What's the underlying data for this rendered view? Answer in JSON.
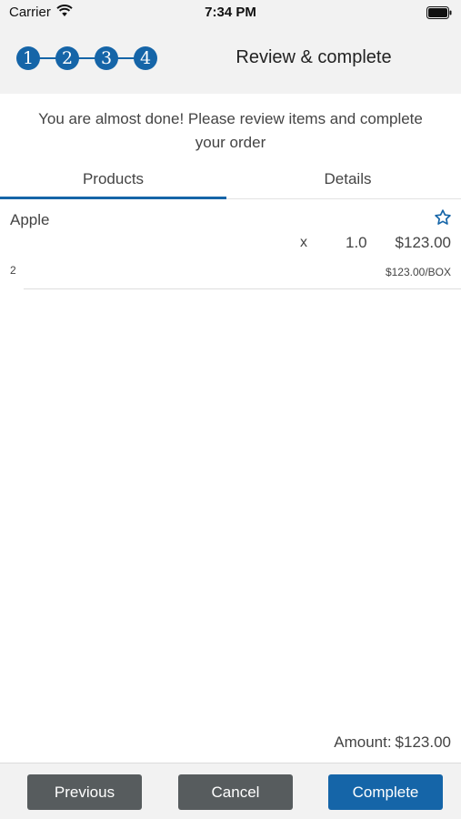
{
  "status_bar": {
    "carrier": "Carrier",
    "time": "7:34 PM"
  },
  "header": {
    "steps": [
      "1",
      "2",
      "3",
      "4"
    ],
    "title": "Review & complete",
    "accent_color": "#1565a8"
  },
  "instructions": "You are almost done! Please review items and complete your order",
  "tabs": [
    {
      "label": "Products",
      "active": true
    },
    {
      "label": "Details",
      "active": false
    }
  ],
  "products": [
    {
      "name": "Apple",
      "favorite_icon": "star-outline-icon",
      "multiply": "x",
      "quantity": "1.0",
      "total": "$123.00",
      "code": "2",
      "unit_price": "$123.00/BOX"
    }
  ],
  "summary": {
    "amount_label": "Amount:",
    "amount_value": "$123.00"
  },
  "buttons": {
    "previous": "Previous",
    "cancel": "Cancel",
    "complete": "Complete"
  }
}
